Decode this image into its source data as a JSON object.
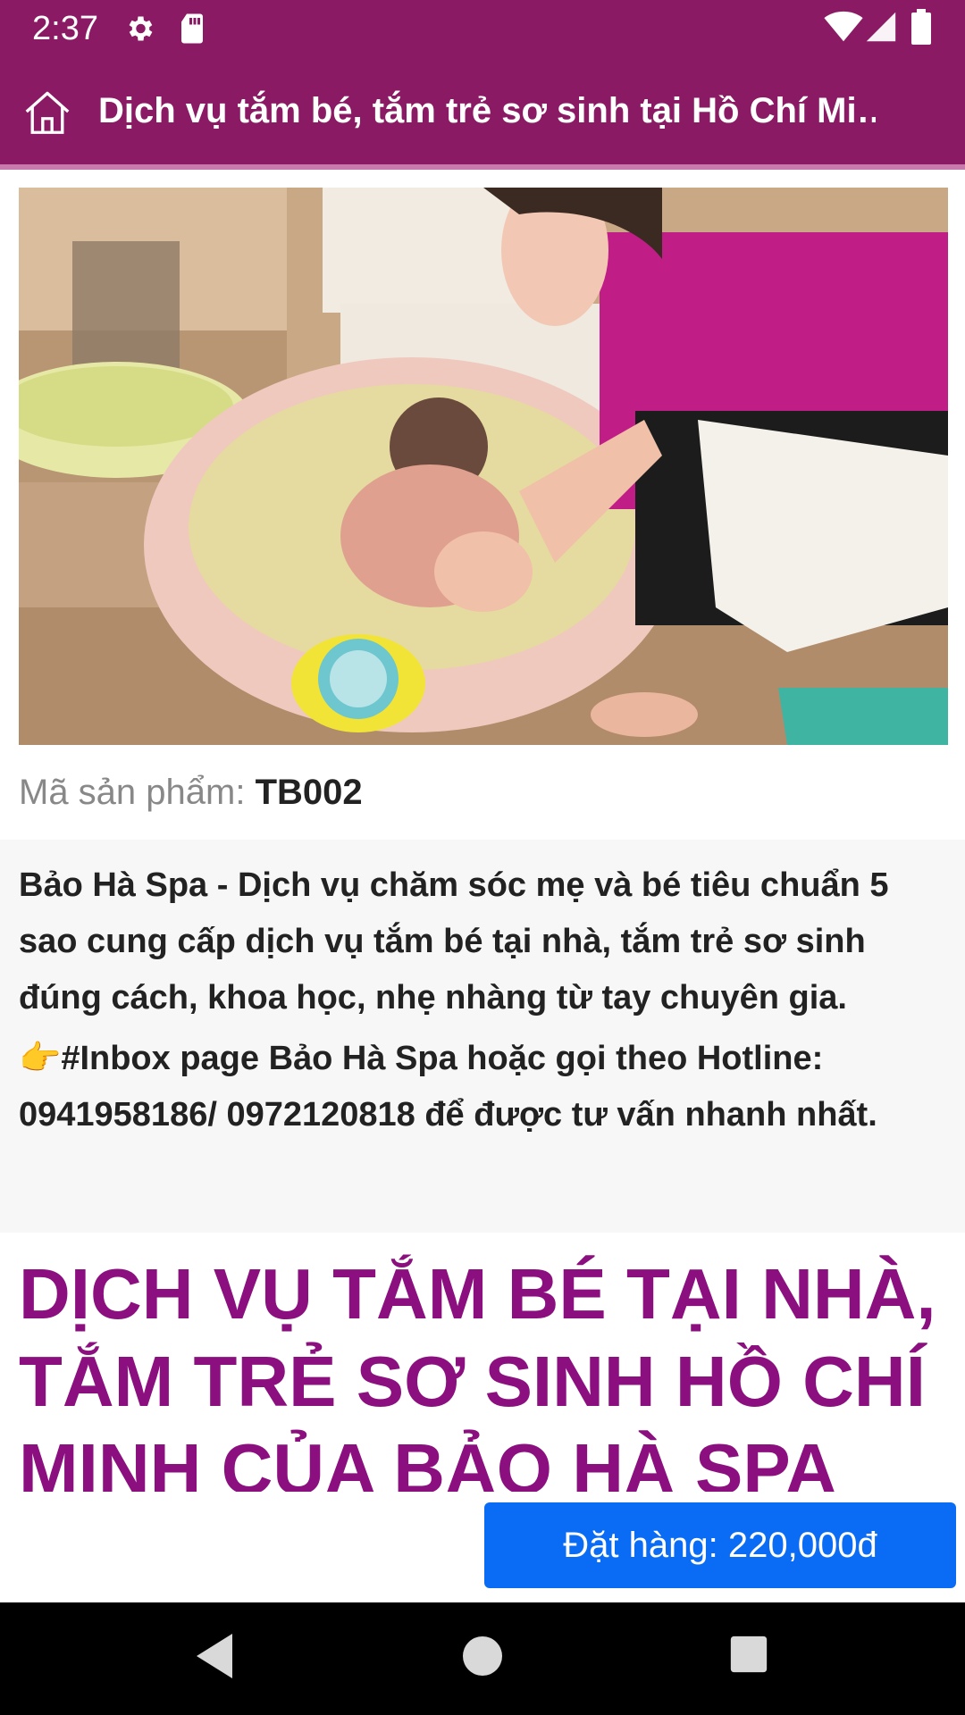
{
  "status_bar": {
    "time": "2:37",
    "icons": [
      "settings-icon",
      "sd-card-icon",
      "wifi-icon",
      "signal-icon",
      "battery-icon"
    ]
  },
  "app_bar": {
    "title": "Dịch vụ tắm bé, tắm trẻ sơ sinh tại Hồ Chí Mi…",
    "home_icon": "home-icon",
    "background_color": "#8a1a63"
  },
  "product": {
    "image_icon": "product-photo",
    "code_label": "Mã sản phẩm: ",
    "code_value": "TB002",
    "description_1": "Bảo Hà Spa - Dịch vụ chăm sóc mẹ và bé tiêu chuẩn 5 sao cung cấp dịch vụ tắm bé tại nhà, tắm trẻ sơ sinh đúng cách, khoa học, nhẹ nhàng từ tay chuyên gia.",
    "description_2": "👉#Inbox page Bảo Hà Spa hoặc gọi theo Hotline: 0941958186/ 0972120818 để được tư vấn nhanh nhất.",
    "headline": "DỊCH VỤ TẮM BÉ TẠI NHÀ, TẮM TRẺ SƠ SINH HỒ CHÍ MINH CỦA BẢO HÀ SPA CÓ"
  },
  "order": {
    "label": "Đặt hàng: 220,000đ",
    "color": "#0a6cf5"
  },
  "nav_bar": {
    "icons": [
      "back-icon",
      "home-circle-icon",
      "recents-icon"
    ]
  }
}
